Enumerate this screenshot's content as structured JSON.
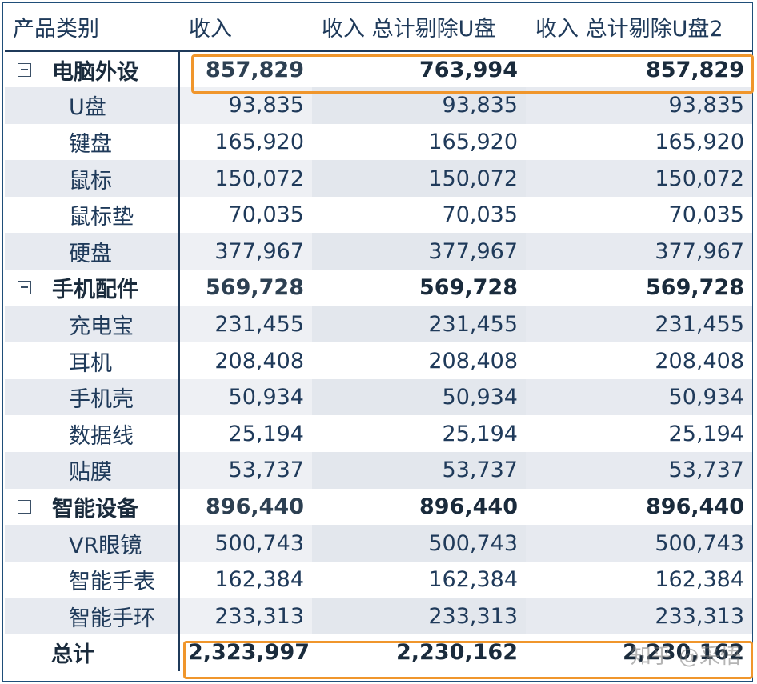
{
  "header": {
    "category": "产品类别",
    "revenue": "收入",
    "revenue_excl": "收入 总计剔除U盘",
    "revenue_excl2": "收入 总计剔除U盘2"
  },
  "groups": [
    {
      "label": "电脑外设",
      "values": [
        "857,829",
        "763,994",
        "857,829"
      ],
      "items": [
        {
          "label": "U盘",
          "values": [
            "93,835",
            "93,835",
            "93,835"
          ]
        },
        {
          "label": "键盘",
          "values": [
            "165,920",
            "165,920",
            "165,920"
          ]
        },
        {
          "label": "鼠标",
          "values": [
            "150,072",
            "150,072",
            "150,072"
          ]
        },
        {
          "label": "鼠标垫",
          "values": [
            "70,035",
            "70,035",
            "70,035"
          ]
        },
        {
          "label": "硬盘",
          "values": [
            "377,967",
            "377,967",
            "377,967"
          ]
        }
      ]
    },
    {
      "label": "手机配件",
      "values": [
        "569,728",
        "569,728",
        "569,728"
      ],
      "items": [
        {
          "label": "充电宝",
          "values": [
            "231,455",
            "231,455",
            "231,455"
          ]
        },
        {
          "label": "耳机",
          "values": [
            "208,408",
            "208,408",
            "208,408"
          ]
        },
        {
          "label": "手机壳",
          "values": [
            "50,934",
            "50,934",
            "50,934"
          ]
        },
        {
          "label": "数据线",
          "values": [
            "25,194",
            "25,194",
            "25,194"
          ]
        },
        {
          "label": "贴膜",
          "values": [
            "53,737",
            "53,737",
            "53,737"
          ]
        }
      ]
    },
    {
      "label": "智能设备",
      "values": [
        "896,440",
        "896,440",
        "896,440"
      ],
      "items": [
        {
          "label": "VR眼镜",
          "values": [
            "500,743",
            "500,743",
            "500,743"
          ]
        },
        {
          "label": "智能手表",
          "values": [
            "162,384",
            "162,384",
            "162,384"
          ]
        },
        {
          "label": "智能手环",
          "values": [
            "233,313",
            "233,313",
            "233,313"
          ]
        }
      ]
    }
  ],
  "total": {
    "label": "总计",
    "values": [
      "2,323,997",
      "2,230,162",
      "2,230,162"
    ]
  },
  "watermark": "知乎 @采悟",
  "colors": {
    "highlight": "#f0962c",
    "header_text": "#1f3a5a",
    "zebra": "#e7eaf0"
  }
}
